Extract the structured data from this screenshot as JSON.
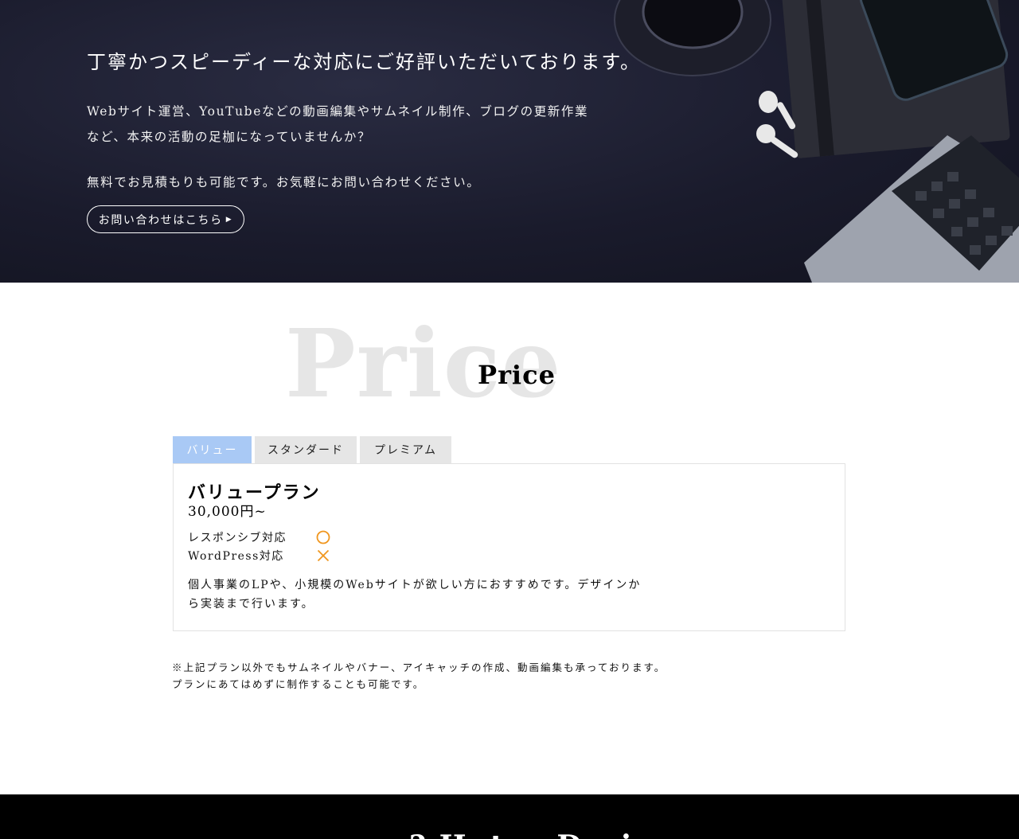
{
  "hero": {
    "title": "丁寧かつスピーディーな対応にご好評いただいております。",
    "line1": "Webサイト運営、YouTubeなどの動画編集やサムネイル制作、ブログの更新作業",
    "line2": "など、本来の活動の足枷になっていませんか？",
    "line3": "無料でお見積もりも可能です。お気軽にお問い合わせください。",
    "button_label": "お問い合わせはこちら",
    "button_arrow": "▶"
  },
  "price": {
    "background_title": "Price",
    "title": "Price",
    "tabs": [
      {
        "label": "バリュー",
        "active": true
      },
      {
        "label": "スタンダード",
        "active": false
      },
      {
        "label": "プレミアム",
        "active": false
      }
    ],
    "plan": {
      "name": "バリュープラン",
      "price": "30,000円~",
      "features": [
        {
          "label": "レスポンシブ対応",
          "mark": "circle-icon"
        },
        {
          "label": "WordPress対応",
          "mark": "cross-icon"
        }
      ],
      "description": "個人事業のLPや、小規模のWebサイトが欲しい方におすすめです。デザインから実装まで行います。"
    },
    "notes": [
      "※上記プラン以外でもサムネイルやバナー、アイキャッチの作成、動画編集も承っております。",
      "プランにあてはめずに制作することも可能です。"
    ]
  },
  "footer": {
    "heading": "? Hutsu Design"
  },
  "colors": {
    "hero_bg": "#1a1b2c",
    "tab_active": "#a9c9f5",
    "tab_inactive": "#e6e6e6",
    "mark_color": "#f0961e",
    "footer_bg": "#000000"
  }
}
